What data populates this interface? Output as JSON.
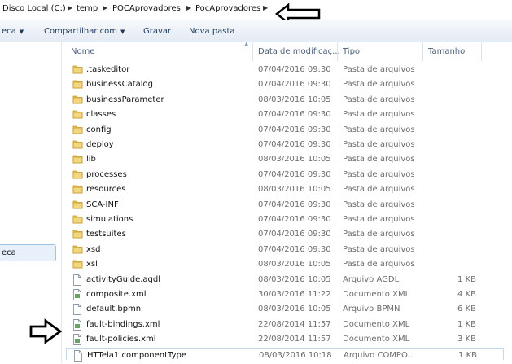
{
  "breadcrumb": [
    "Disco Local (C:)",
    "temp",
    "POCAprovadores",
    "PocAprovadores"
  ],
  "toolbar": {
    "library": "eca",
    "share": "Compartilhar com",
    "burn": "Gravar",
    "new_folder": "Nova pasta"
  },
  "columns": {
    "name": "Nome",
    "date": "Data de modificaç...",
    "type": "Tipo",
    "size": "Tamanho"
  },
  "nav": {
    "selected_label": "eca"
  },
  "files": [
    {
      "name": ".taskeditor",
      "date": "07/04/2016 09:30",
      "type": "Pasta de arquivos",
      "size": "",
      "icon": "folder-icon"
    },
    {
      "name": "businessCatalog",
      "date": "07/04/2016 09:30",
      "type": "Pasta de arquivos",
      "size": "",
      "icon": "folder-icon"
    },
    {
      "name": "businessParameter",
      "date": "08/03/2016 10:05",
      "type": "Pasta de arquivos",
      "size": "",
      "icon": "folder-icon"
    },
    {
      "name": "classes",
      "date": "07/04/2016 09:30",
      "type": "Pasta de arquivos",
      "size": "",
      "icon": "folder-icon"
    },
    {
      "name": "config",
      "date": "07/04/2016 09:30",
      "type": "Pasta de arquivos",
      "size": "",
      "icon": "folder-icon"
    },
    {
      "name": "deploy",
      "date": "07/04/2016 09:30",
      "type": "Pasta de arquivos",
      "size": "",
      "icon": "folder-icon"
    },
    {
      "name": "lib",
      "date": "08/03/2016 10:05",
      "type": "Pasta de arquivos",
      "size": "",
      "icon": "folder-icon"
    },
    {
      "name": "processes",
      "date": "07/04/2016 09:30",
      "type": "Pasta de arquivos",
      "size": "",
      "icon": "folder-icon"
    },
    {
      "name": "resources",
      "date": "08/03/2016 10:05",
      "type": "Pasta de arquivos",
      "size": "",
      "icon": "folder-icon"
    },
    {
      "name": "SCA-INF",
      "date": "07/04/2016 09:30",
      "type": "Pasta de arquivos",
      "size": "",
      "icon": "folder-icon"
    },
    {
      "name": "simulations",
      "date": "07/04/2016 09:30",
      "type": "Pasta de arquivos",
      "size": "",
      "icon": "folder-icon"
    },
    {
      "name": "testsuites",
      "date": "07/04/2016 09:30",
      "type": "Pasta de arquivos",
      "size": "",
      "icon": "folder-icon"
    },
    {
      "name": "xsd",
      "date": "07/04/2016 09:30",
      "type": "Pasta de arquivos",
      "size": "",
      "icon": "folder-icon"
    },
    {
      "name": "xsl",
      "date": "08/03/2016 10:05",
      "type": "Pasta de arquivos",
      "size": "",
      "icon": "folder-icon"
    },
    {
      "name": "activityGuide.agdl",
      "date": "08/03/2016 10:05",
      "type": "Arquivo AGDL",
      "size": "1 KB",
      "icon": "file-icon"
    },
    {
      "name": "composite.xml",
      "date": "30/03/2016 11:22",
      "type": "Documento XML",
      "size": "4 KB",
      "icon": "xml-file-icon"
    },
    {
      "name": "default.bpmn",
      "date": "08/03/2016 10:05",
      "type": "Arquivo BPMN",
      "size": "6 KB",
      "icon": "file-icon"
    },
    {
      "name": "fault-bindings.xml",
      "date": "22/08/2014 11:57",
      "type": "Documento XML",
      "size": "1 KB",
      "icon": "xml-file-icon"
    },
    {
      "name": "fault-policies.xml",
      "date": "22/08/2014 11:57",
      "type": "Documento XML",
      "size": "3 KB",
      "icon": "xml-file-icon"
    },
    {
      "name": "HTTela1.componentType",
      "date": "08/03/2016 10:18",
      "type": "Arquivo COMPO...",
      "size": "1 KB",
      "icon": "file-icon"
    }
  ]
}
